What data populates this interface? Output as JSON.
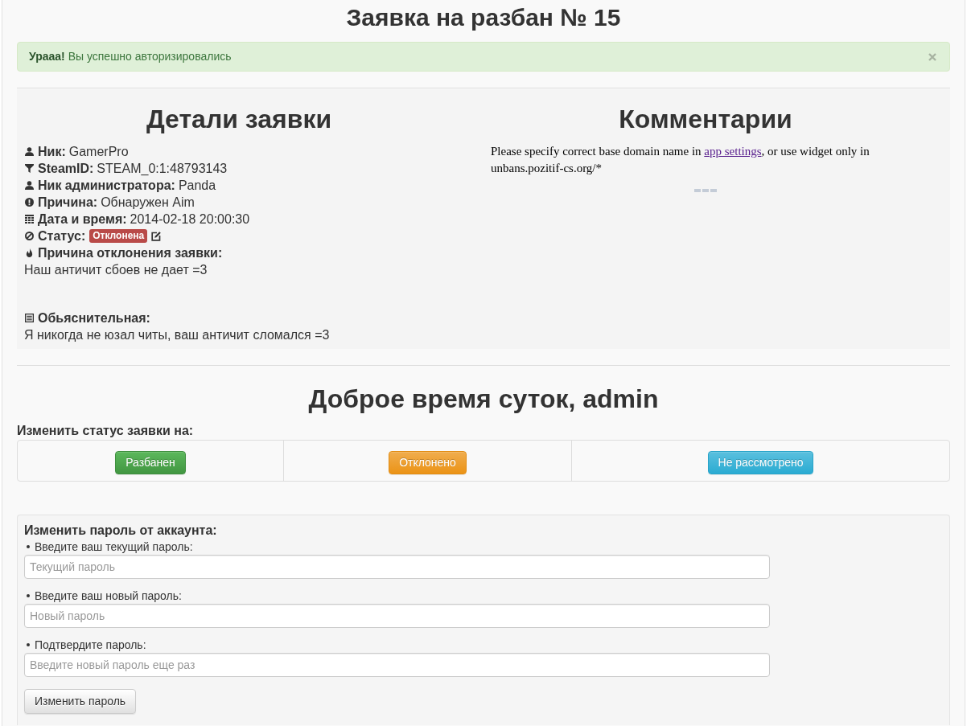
{
  "page_title": "Заявка на разбан № 15",
  "alert": {
    "message": "**Урааа!** Вы успешно авторизировались",
    "dismissible": true
  },
  "details": {
    "title": "Детали заявки",
    "fields": [
      {
        "kind": "player",
        "label": "Ник:",
        "value": "GamerPro"
      },
      {
        "kind": "steamid",
        "label": "SteamID:",
        "value": "STEAM_0:1:48793143"
      },
      {
        "kind": "admin",
        "label": "Ник администратора:",
        "value": "Panda"
      },
      {
        "kind": "reason",
        "label": "Причина:",
        "value": "Обнаружен Aim"
      },
      {
        "kind": "datetime",
        "label": "Дата и время:",
        "value": "2014-02-18 20:00:30"
      },
      {
        "kind": "status",
        "label": "Статус:",
        "value": "Отклонена"
      },
      {
        "kind": "rejection",
        "label": "Причина отклонения заявки:",
        "value": "Наш античит сбоев не дает =3"
      },
      {
        "kind": "explanation",
        "label": "Обьяснительная:",
        "value": "Я никогда не юзал читы, ваш античит сломался =3"
      }
    ]
  },
  "comments": {
    "title": "Комментарии",
    "notice": {
      "before": "Please specify correct base domain name in",
      "link": "app settings",
      "after": ", or use widget only in unbans.pozitif-cs.org/*"
    },
    "loading": true
  },
  "greeting": "Доброе время суток, admin",
  "status_change": {
    "label": "Изменить статус заявки на:",
    "buttons": [
      {
        "label": "Разбанен",
        "kind": "success"
      },
      {
        "label": "Отклонено",
        "kind": "warning"
      },
      {
        "label": "Не рассмотрено",
        "kind": "info"
      }
    ]
  },
  "password_form": {
    "title": "Изменить пароль от аккаунта:",
    "fields": [
      {
        "label": "Введите ваш текущий пароль:",
        "placeholder": "Текущий пароль"
      },
      {
        "label": "Введите ваш новый пароль:",
        "placeholder": "Новый пароль"
      },
      {
        "label": "Подтвердите пароль:",
        "placeholder": "Введите новый пароль еще раз"
      }
    ],
    "submit": "Изменить пароль"
  }
}
